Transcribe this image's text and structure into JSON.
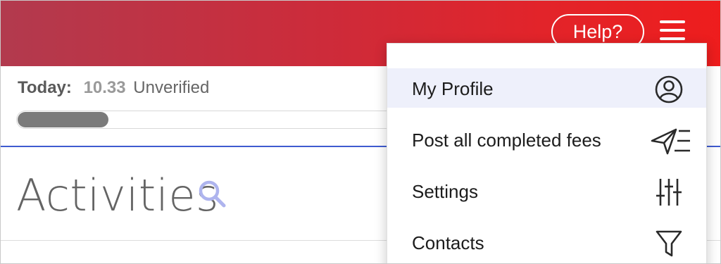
{
  "header": {
    "help_label": "Help?",
    "background_gradient": [
      "#b23a4e",
      "#ee1d1d"
    ]
  },
  "summary": {
    "today_label": "Today:",
    "today_value": "10.33",
    "today_status": "Unverified",
    "progress_fraction": 0.24
  },
  "activities": {
    "title": "Activities"
  },
  "menu": {
    "items": [
      {
        "label": "My Profile",
        "icon": "user-circle-icon",
        "active": true
      },
      {
        "label": "Post all completed fees",
        "icon": "send-list-icon",
        "active": false
      },
      {
        "label": "Settings",
        "icon": "sliders-icon",
        "active": false
      },
      {
        "label": "Contacts",
        "icon": "filter-icon",
        "active": false
      }
    ]
  },
  "colors": {
    "accent_blue": "#3f5bd0",
    "search_icon": "#aeb4ee",
    "active_item_bg": "#eef0fb"
  }
}
